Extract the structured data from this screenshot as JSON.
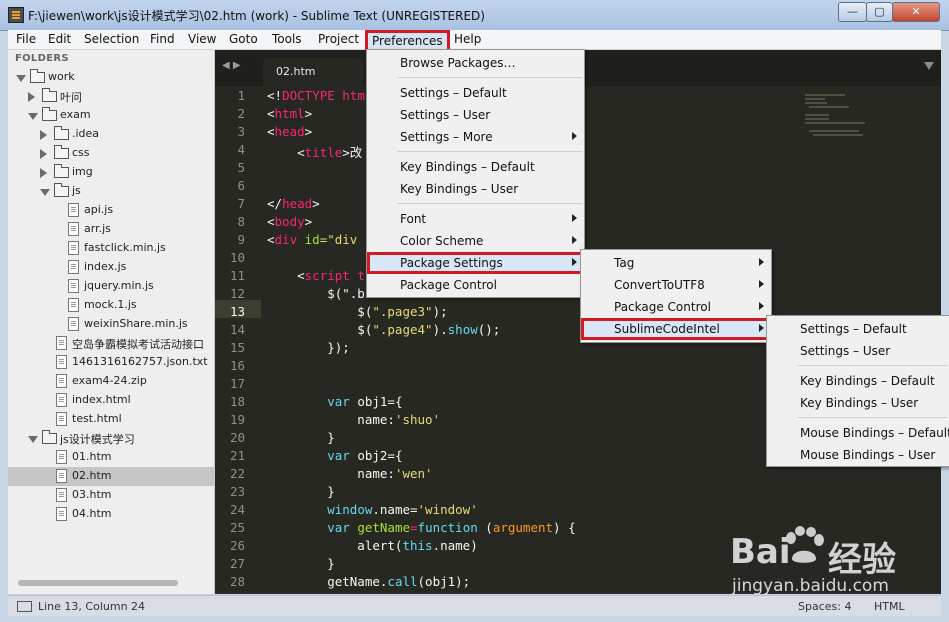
{
  "window": {
    "title": "F:\\jiewen\\work\\js设计模式学习\\02.htm (work) - Sublime Text (UNREGISTERED)",
    "minimize": "—",
    "maximize": "▢",
    "close": "✕"
  },
  "menubar": {
    "items": [
      "File",
      "Edit",
      "Selection",
      "Find",
      "View",
      "Goto",
      "Tools",
      "Project",
      "Preferences",
      "Help"
    ]
  },
  "sidebar": {
    "header": "FOLDERS",
    "tree": [
      {
        "label": "work",
        "type": "folder",
        "state": "open",
        "depth": 0
      },
      {
        "label": "叶问",
        "type": "folder",
        "state": "closed",
        "depth": 1
      },
      {
        "label": "exam",
        "type": "folder",
        "state": "open",
        "depth": 1
      },
      {
        "label": ".idea",
        "type": "folder",
        "state": "closed",
        "depth": 2
      },
      {
        "label": "css",
        "type": "folder",
        "state": "closed",
        "depth": 2
      },
      {
        "label": "img",
        "type": "folder",
        "state": "closed",
        "depth": 2
      },
      {
        "label": "js",
        "type": "folder",
        "state": "open",
        "depth": 2
      },
      {
        "label": "api.js",
        "type": "file",
        "depth": 3
      },
      {
        "label": "arr.js",
        "type": "file",
        "depth": 3
      },
      {
        "label": "fastclick.min.js",
        "type": "file",
        "depth": 3
      },
      {
        "label": "index.js",
        "type": "file",
        "depth": 3
      },
      {
        "label": "jquery.min.js",
        "type": "file",
        "depth": 3
      },
      {
        "label": "mock.1.js",
        "type": "file",
        "depth": 3
      },
      {
        "label": "weixinShare.min.js",
        "type": "file",
        "depth": 3
      },
      {
        "label": "空岛争霸模拟考试活动接口",
        "type": "file",
        "depth": 2
      },
      {
        "label": "1461316162757.json.txt",
        "type": "file",
        "depth": 2
      },
      {
        "label": "exam4-24.zip",
        "type": "file",
        "depth": 2
      },
      {
        "label": "index.html",
        "type": "file",
        "depth": 2
      },
      {
        "label": "test.html",
        "type": "file",
        "depth": 2
      },
      {
        "label": "js设计模式学习",
        "type": "folder",
        "state": "open",
        "depth": 1
      },
      {
        "label": "01.htm",
        "type": "file",
        "depth": 2
      },
      {
        "label": "02.htm",
        "type": "file",
        "depth": 2,
        "selected": true
      },
      {
        "label": "03.htm",
        "type": "file",
        "depth": 2
      },
      {
        "label": "04.htm",
        "type": "file",
        "depth": 2
      }
    ]
  },
  "editor": {
    "tab_label": "02.htm",
    "tab_nav": "◀ ▶",
    "current_line": 13,
    "lines": [
      [
        [
          "<!",
          "#f8f8f2"
        ],
        [
          "DOCTYPE htm",
          "#f92672"
        ]
      ],
      [
        [
          "<",
          "#f8f8f2"
        ],
        [
          "html",
          "#f92672"
        ],
        [
          ">",
          "#f8f8f2"
        ]
      ],
      [
        [
          "<",
          "#f8f8f2"
        ],
        [
          "head",
          "#f92672"
        ],
        [
          ">",
          "#f8f8f2"
        ]
      ],
      [
        [
          "    <",
          "#f8f8f2"
        ],
        [
          "title",
          "#f92672"
        ],
        [
          ">改",
          "#f8f8f2"
        ]
      ],
      [],
      [],
      [
        [
          "</",
          "#f8f8f2"
        ],
        [
          "head",
          "#f92672"
        ],
        [
          ">",
          "#f8f8f2"
        ]
      ],
      [
        [
          "<",
          "#f8f8f2"
        ],
        [
          "body",
          "#f92672"
        ],
        [
          ">",
          "#f8f8f2"
        ]
      ],
      [
        [
          "<",
          "#f8f8f2"
        ],
        [
          "div ",
          "#f92672"
        ],
        [
          "id",
          "#a6e22e"
        ],
        [
          "=\"div",
          "#e6db74"
        ]
      ],
      [],
      [
        [
          "    <",
          "#f8f8f2"
        ],
        [
          "script t",
          "#f92672"
        ]
      ],
      [
        [
          "        $(\".b",
          "#f8f8f2"
        ]
      ],
      [
        [
          "            $(",
          "#f8f8f2"
        ],
        [
          "\".page3\"",
          "#e6db74"
        ],
        [
          ");",
          "#f8f8f2"
        ]
      ],
      [
        [
          "            $(",
          "#f8f8f2"
        ],
        [
          "\".page4\"",
          "#e6db74"
        ],
        [
          ").",
          "#f8f8f2"
        ],
        [
          "show",
          "#66d9ef"
        ],
        [
          "();",
          "#f8f8f2"
        ]
      ],
      [
        [
          "        });",
          "#f8f8f2"
        ]
      ],
      [],
      [],
      [
        [
          "        ",
          "#f8f8f2"
        ],
        [
          "var",
          "#66d9ef"
        ],
        [
          " obj1=",
          "#f8f8f2"
        ],
        [
          "{",
          "#f8f8f2"
        ]
      ],
      [
        [
          "            name:",
          "#f8f8f2"
        ],
        [
          "'shuo'",
          "#e6db74"
        ]
      ],
      [
        [
          "        }",
          "#f8f8f2"
        ]
      ],
      [
        [
          "        ",
          "#f8f8f2"
        ],
        [
          "var",
          "#66d9ef"
        ],
        [
          " obj2=",
          "#f8f8f2"
        ],
        [
          "{",
          "#f8f8f2"
        ]
      ],
      [
        [
          "            name:",
          "#f8f8f2"
        ],
        [
          "'wen'",
          "#e6db74"
        ]
      ],
      [
        [
          "        }",
          "#f8f8f2"
        ]
      ],
      [
        [
          "        ",
          "#f8f8f2"
        ],
        [
          "window",
          "#66d9ef"
        ],
        [
          ".name=",
          "#f8f8f2"
        ],
        [
          "'window'",
          "#e6db74"
        ]
      ],
      [
        [
          "        ",
          "#f8f8f2"
        ],
        [
          "var",
          "#66d9ef"
        ],
        [
          " ",
          "#f8f8f2"
        ],
        [
          "getName",
          "#a6e22e"
        ],
        [
          "=",
          "#f92672"
        ],
        [
          "function",
          "#66d9ef"
        ],
        [
          " (",
          "#f8f8f2"
        ],
        [
          "argument",
          "#fd971f"
        ],
        [
          ") {",
          "#f8f8f2"
        ]
      ],
      [
        [
          "            alert(",
          "#f8f8f2"
        ],
        [
          "this",
          "#66d9ef"
        ],
        [
          ".name)",
          "#f8f8f2"
        ]
      ],
      [
        [
          "        }",
          "#f8f8f2"
        ]
      ],
      [
        [
          "        getName.",
          "#f8f8f2"
        ],
        [
          "call",
          "#66d9ef"
        ],
        [
          "(obj1);",
          "#f8f8f2"
        ]
      ]
    ]
  },
  "menus": {
    "preferences": [
      {
        "label": "Browse Packages…"
      },
      {
        "sep": true
      },
      {
        "label": "Settings – Default"
      },
      {
        "label": "Settings – User"
      },
      {
        "label": "Settings – More",
        "sub": true
      },
      {
        "sep": true
      },
      {
        "label": "Key Bindings – Default"
      },
      {
        "label": "Key Bindings – User"
      },
      {
        "sep": true
      },
      {
        "label": "Font",
        "sub": true
      },
      {
        "label": "Color Scheme",
        "sub": true
      },
      {
        "label": "Package Settings",
        "sub": true,
        "hl": true
      },
      {
        "label": "Package Control"
      }
    ],
    "package_settings": [
      {
        "label": "Tag",
        "sub": true
      },
      {
        "label": "ConvertToUTF8",
        "sub": true
      },
      {
        "label": "Package Control",
        "sub": true
      },
      {
        "label": "SublimeCodeIntel",
        "sub": true,
        "hl": true
      }
    ],
    "codeintel": [
      {
        "label": "Settings – Default"
      },
      {
        "label": "Settings – User"
      },
      {
        "sep": true
      },
      {
        "label": "Key Bindings – Default"
      },
      {
        "label": "Key Bindings – User"
      },
      {
        "sep": true
      },
      {
        "label": "Mouse Bindings – Default"
      },
      {
        "label": "Mouse Bindings – User"
      }
    ]
  },
  "statusbar": {
    "position": "Line 13, Column 24",
    "spaces": "Spaces: 4",
    "syntax": "HTML"
  },
  "watermark": {
    "brand": "Bai",
    "brand_cn": "经验",
    "url": "jingyan.baidu.com"
  },
  "colors": {
    "highlight_border": "#d21a22",
    "editor_bg": "#272822",
    "menu_bg": "#f0f0f0"
  }
}
